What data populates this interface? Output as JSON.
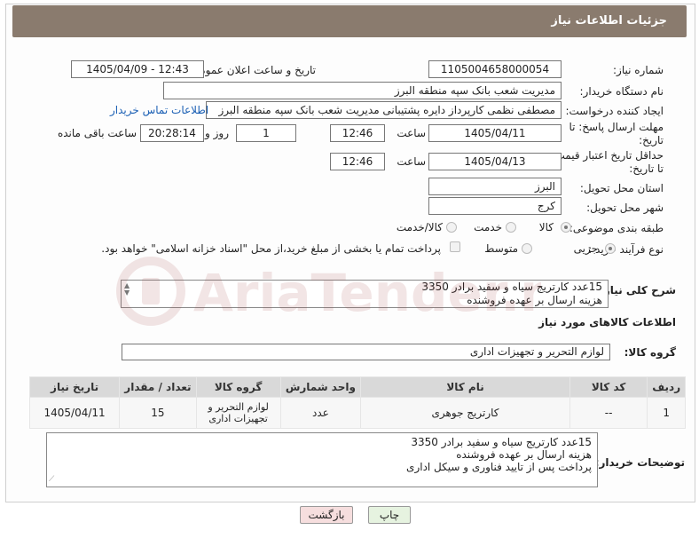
{
  "header": {
    "title": "جزئیات اطلاعات نیاز"
  },
  "form": {
    "need_number_label": "شماره نیاز:",
    "need_number": "1105004658000054",
    "announce_label": "تاریخ و ساعت اعلان عمومی:",
    "announce_value": "1405/04/09 - 12:43",
    "buyer_label": "نام دستگاه خریدار:",
    "buyer_value": "مدیریت شعب بانک سپه منطقه البرز",
    "creator_label": "ایجاد کننده درخواست:",
    "creator_value": "مصطفی نظمی کارپرداز دایره پشتیبانی مدیریت شعب بانک سپه منطقه البرز",
    "contact_link": "اطلاعات تماس خریدار",
    "deadline_label_1": "مهلت ارسال پاسخ: تا",
    "deadline_label_2": "تاریخ:",
    "deadline_date": "1405/04/11",
    "time_label": "ساعت",
    "deadline_time": "12:46",
    "days_value": "1",
    "days_label": "روز و",
    "remaining_time": "20:28:14",
    "remaining_label": "ساعت باقی مانده",
    "validity_label_1": "حداقل تاریخ اعتبار قیمت:",
    "validity_label_2": "تا تاریخ:",
    "validity_date": "1405/04/13",
    "validity_time_label": "ساعت",
    "validity_time": "12:46",
    "province_label": "استان محل تحویل:",
    "province_value": "البرز",
    "city_label": "شهر محل تحویل:",
    "city_value": "کرج",
    "category_label": "طبقه بندی موضوعی:",
    "category_options": [
      "کالا",
      "خدمت",
      "کالا/خدمت"
    ],
    "category_selected": "کالا",
    "process_label": "نوع فرآیند خرید :",
    "process_options": [
      "جزیی",
      "متوسط"
    ],
    "process_selected": "جزیی",
    "payment_note": "پرداخت تمام یا بخشی از مبلغ خرید،از محل \"اسناد خزانه اسلامی\" خواهد بود."
  },
  "summary": {
    "label": "شرح کلی نیاز:",
    "line1": "15عدد کارتریج سیاه و سفید برادر 3350",
    "line2": "هزینه ارسال بر عهده فروشنده"
  },
  "goods_section": {
    "title": "اطلاعات کالاهای مورد نیاز",
    "group_label": "گروه کالا:",
    "group_value": "لوازم التحریر و تجهیزات اداری"
  },
  "table": {
    "headers": [
      "ردیف",
      "کد کالا",
      "نام کالا",
      "واحد شمارش",
      "گروه کالا",
      "تعداد / مقدار",
      "تاریخ نیاز"
    ],
    "rows": [
      {
        "row": "1",
        "code": "--",
        "name": "کارتریج جوهری",
        "unit": "عدد",
        "group": "لوازم التحریر و تجهیزات اداری",
        "qty": "15",
        "date": "1405/04/11"
      }
    ]
  },
  "buyer_notes": {
    "label": "توضیحات خریدار:",
    "line1": "15عدد کارتریج سیاه و سفید برادر 3350",
    "line2": "هزینه ارسال بر عهده فروشنده",
    "line3": "پرداخت پس از تایید فناوری و سیکل اداری"
  },
  "buttons": {
    "print": "چاپ",
    "back": "بازگشت"
  },
  "watermark": {
    "text": "AriaTender.neT"
  },
  "colors": {
    "header": "#8a7b6e",
    "link": "#1a5fb4",
    "back_button": "#f6dede",
    "print_button": "#e6f3e0"
  }
}
